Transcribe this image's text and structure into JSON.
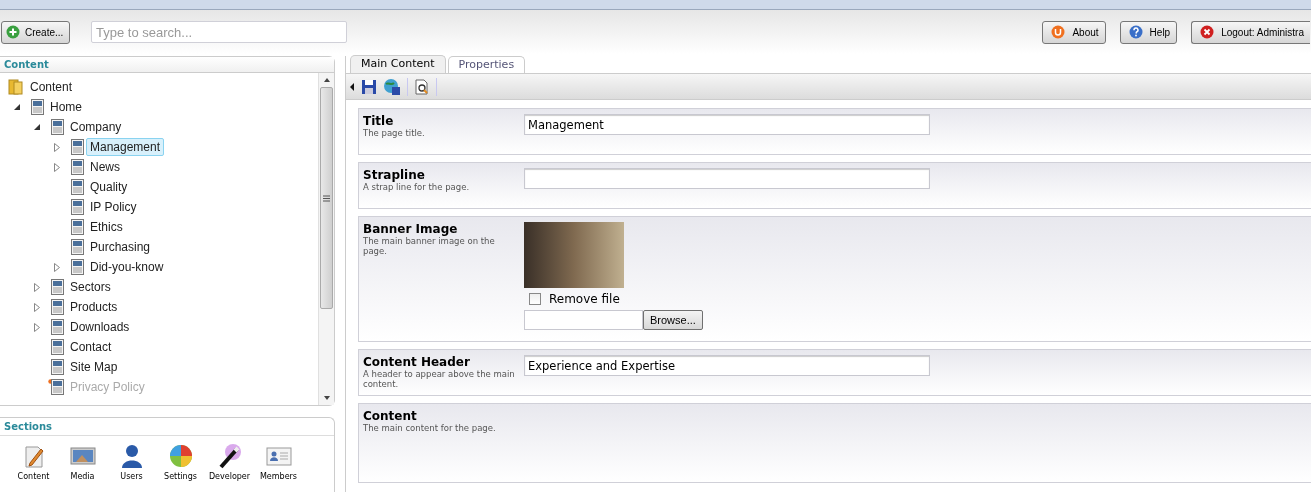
{
  "toolbar": {
    "create_button": "Create...",
    "search": {
      "placeholder": "Type to search..."
    },
    "buttons": [
      {
        "kind": "about",
        "label": "About"
      },
      {
        "kind": "help",
        "label": "Help"
      },
      {
        "kind": "logout",
        "label": "Logout: Administra"
      }
    ]
  },
  "content_panel": {
    "title": "Content",
    "tree": [
      {
        "label": "Content",
        "kind": "folder",
        "selected": false,
        "published": true,
        "children": [
          {
            "label": "Home",
            "kind": "page",
            "expanded": true,
            "selected": false,
            "published": true,
            "children": [
              {
                "label": "Company",
                "kind": "page",
                "expanded": true,
                "selected": false,
                "published": true,
                "children": [
                  {
                    "label": "Management",
                    "kind": "page",
                    "expanded": false,
                    "selected": true,
                    "published": true
                  },
                  {
                    "label": "News",
                    "kind": "page",
                    "expanded": false,
                    "selected": false,
                    "published": true
                  },
                  {
                    "label": "Quality",
                    "kind": "page",
                    "selected": false,
                    "published": true
                  },
                  {
                    "label": "IP Policy",
                    "kind": "page",
                    "selected": false,
                    "published": true
                  },
                  {
                    "label": "Ethics",
                    "kind": "page",
                    "selected": false,
                    "published": true
                  },
                  {
                    "label": "Purchasing",
                    "kind": "page",
                    "selected": false,
                    "published": true
                  },
                  {
                    "label": "Did-you-know",
                    "kind": "page",
                    "expanded": false,
                    "selected": false,
                    "published": true
                  }
                ]
              },
              {
                "label": "Sectors",
                "kind": "page",
                "expanded": false,
                "selected": false,
                "published": true
              },
              {
                "label": "Products",
                "kind": "page",
                "expanded": false,
                "selected": false,
                "published": true
              },
              {
                "label": "Downloads",
                "kind": "page",
                "expanded": false,
                "selected": false,
                "published": true
              },
              {
                "label": "Contact",
                "kind": "page",
                "selected": false,
                "published": true
              },
              {
                "label": "Site Map",
                "kind": "page",
                "selected": false,
                "published": true
              },
              {
                "label": "Privacy Policy",
                "kind": "page",
                "selected": false,
                "published": false
              }
            ]
          }
        ]
      }
    ]
  },
  "sections_panel": {
    "title": "Sections",
    "items": [
      {
        "kind": "content",
        "label": "Content"
      },
      {
        "kind": "media",
        "label": "Media"
      },
      {
        "kind": "users",
        "label": "Users"
      },
      {
        "kind": "settings",
        "label": "Settings"
      },
      {
        "kind": "developer",
        "label": "Developer"
      },
      {
        "kind": "members",
        "label": "Members"
      }
    ]
  },
  "editor": {
    "tabs": [
      {
        "label": "Main Content",
        "selected": true
      },
      {
        "label": "Properties",
        "selected": false
      }
    ],
    "fields": [
      {
        "kind": "text",
        "label": "Title",
        "description": "The page title.",
        "value": "Management"
      },
      {
        "kind": "text",
        "label": "Strapline",
        "description": "A strap line for the page."
      },
      {
        "kind": "image",
        "label": "Banner Image",
        "description": "The main banner image on the page.",
        "remove_label": "Remove file",
        "remove_checked": false,
        "browse_button": "Browse..."
      },
      {
        "kind": "text",
        "label": "Content Header",
        "description": "A header to appear above the main content.",
        "value": "Experience and Expertise"
      },
      {
        "kind": "richtext",
        "label": "Content",
        "description": "The main content for the page."
      }
    ]
  }
}
